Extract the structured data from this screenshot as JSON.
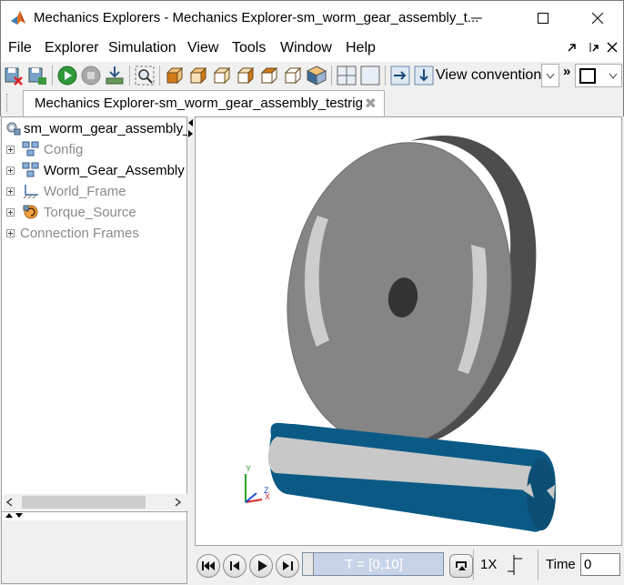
{
  "window": {
    "title": "Mechanics Explorers - Mechanics Explorer-sm_worm_gear_assembly_t..."
  },
  "menu": {
    "items": [
      {
        "label": "File"
      },
      {
        "label": "Explorer"
      },
      {
        "label": "Simulation"
      },
      {
        "label": "View"
      },
      {
        "label": "Tools"
      },
      {
        "label": "Window"
      },
      {
        "label": "Help"
      }
    ]
  },
  "toolbar": {
    "view_convention_label": "View convention:",
    "overflow_label": "»",
    "icons": [
      "close-model-icon",
      "save-model-icon",
      "run-icon",
      "stop-icon",
      "import-icon",
      "zoom-fit-icon",
      "view-front-icon",
      "view-back-icon",
      "view-left-icon",
      "view-right-icon",
      "view-top-icon",
      "view-iso-icon",
      "split-view-icon",
      "single-view-icon",
      "arrow-right-icon",
      "arrow-down-icon",
      "view-select-icon"
    ]
  },
  "tab": {
    "label": "Mechanics Explorer-sm_worm_gear_assembly_testrig",
    "close_glyph": "✖"
  },
  "tree": {
    "root": "sm_worm_gear_assembly_t",
    "items": [
      {
        "label": "Config",
        "icon": "subsystem-icon",
        "active": false
      },
      {
        "label": "Worm_Gear_Assembly",
        "icon": "subsystem-icon",
        "active": true
      },
      {
        "label": "World_Frame",
        "icon": "world-frame-icon",
        "active": false
      },
      {
        "label": "Torque_Source",
        "icon": "torque-source-icon",
        "active": false
      },
      {
        "label": "Connection Frames",
        "icon": "",
        "active": false
      }
    ]
  },
  "playback": {
    "time_range": "T = [0,10]",
    "speed": "1X",
    "time_label": "Time",
    "time_value": "0"
  },
  "triad": {
    "x": "X",
    "y": "Y",
    "z": "Z"
  },
  "colors": {
    "gear": "#8a8a8a",
    "gear_rim": "#555555",
    "worm": "#0b5a86",
    "worm_stripe": "#c8c8c8",
    "slot": "#d0d0d0"
  }
}
